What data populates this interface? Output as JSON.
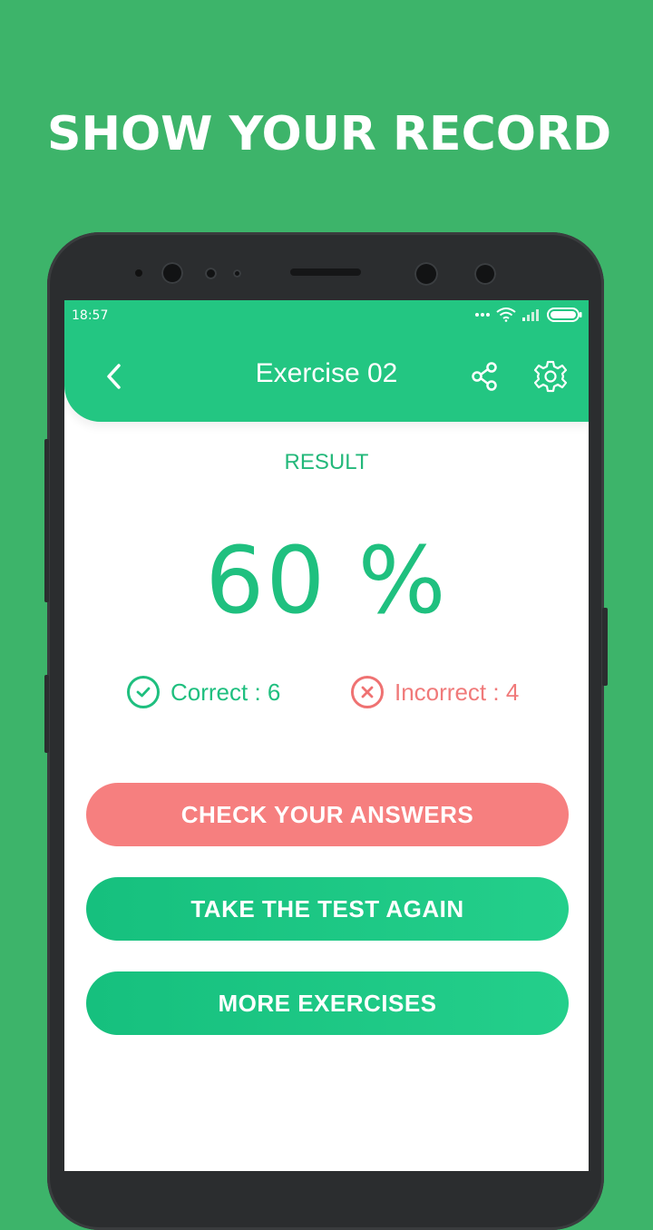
{
  "headline": "SHOW YOUR RECORD",
  "status_bar": {
    "time": "18:57",
    "icons": [
      "dots-icon",
      "wifi-icon",
      "signal-icon",
      "battery-icon"
    ]
  },
  "appbar": {
    "title": "Exercise 02",
    "icons": [
      "back-chevron-icon",
      "share-icon",
      "settings-gear-icon"
    ]
  },
  "result": {
    "label": "RESULT",
    "score_text": "60 %",
    "correct": "Correct : 6",
    "incorrect": "Incorrect : 4"
  },
  "actions": {
    "check_answers": "CHECK YOUR ANSWERS",
    "take_again": "TAKE THE TEST AGAIN",
    "more_exercises": "MORE EXERCISES"
  },
  "colors": {
    "background": "#3db46a",
    "appbar": "#23c682",
    "accent_green": "#1fbf7f",
    "accent_red": "#f67f7f"
  }
}
